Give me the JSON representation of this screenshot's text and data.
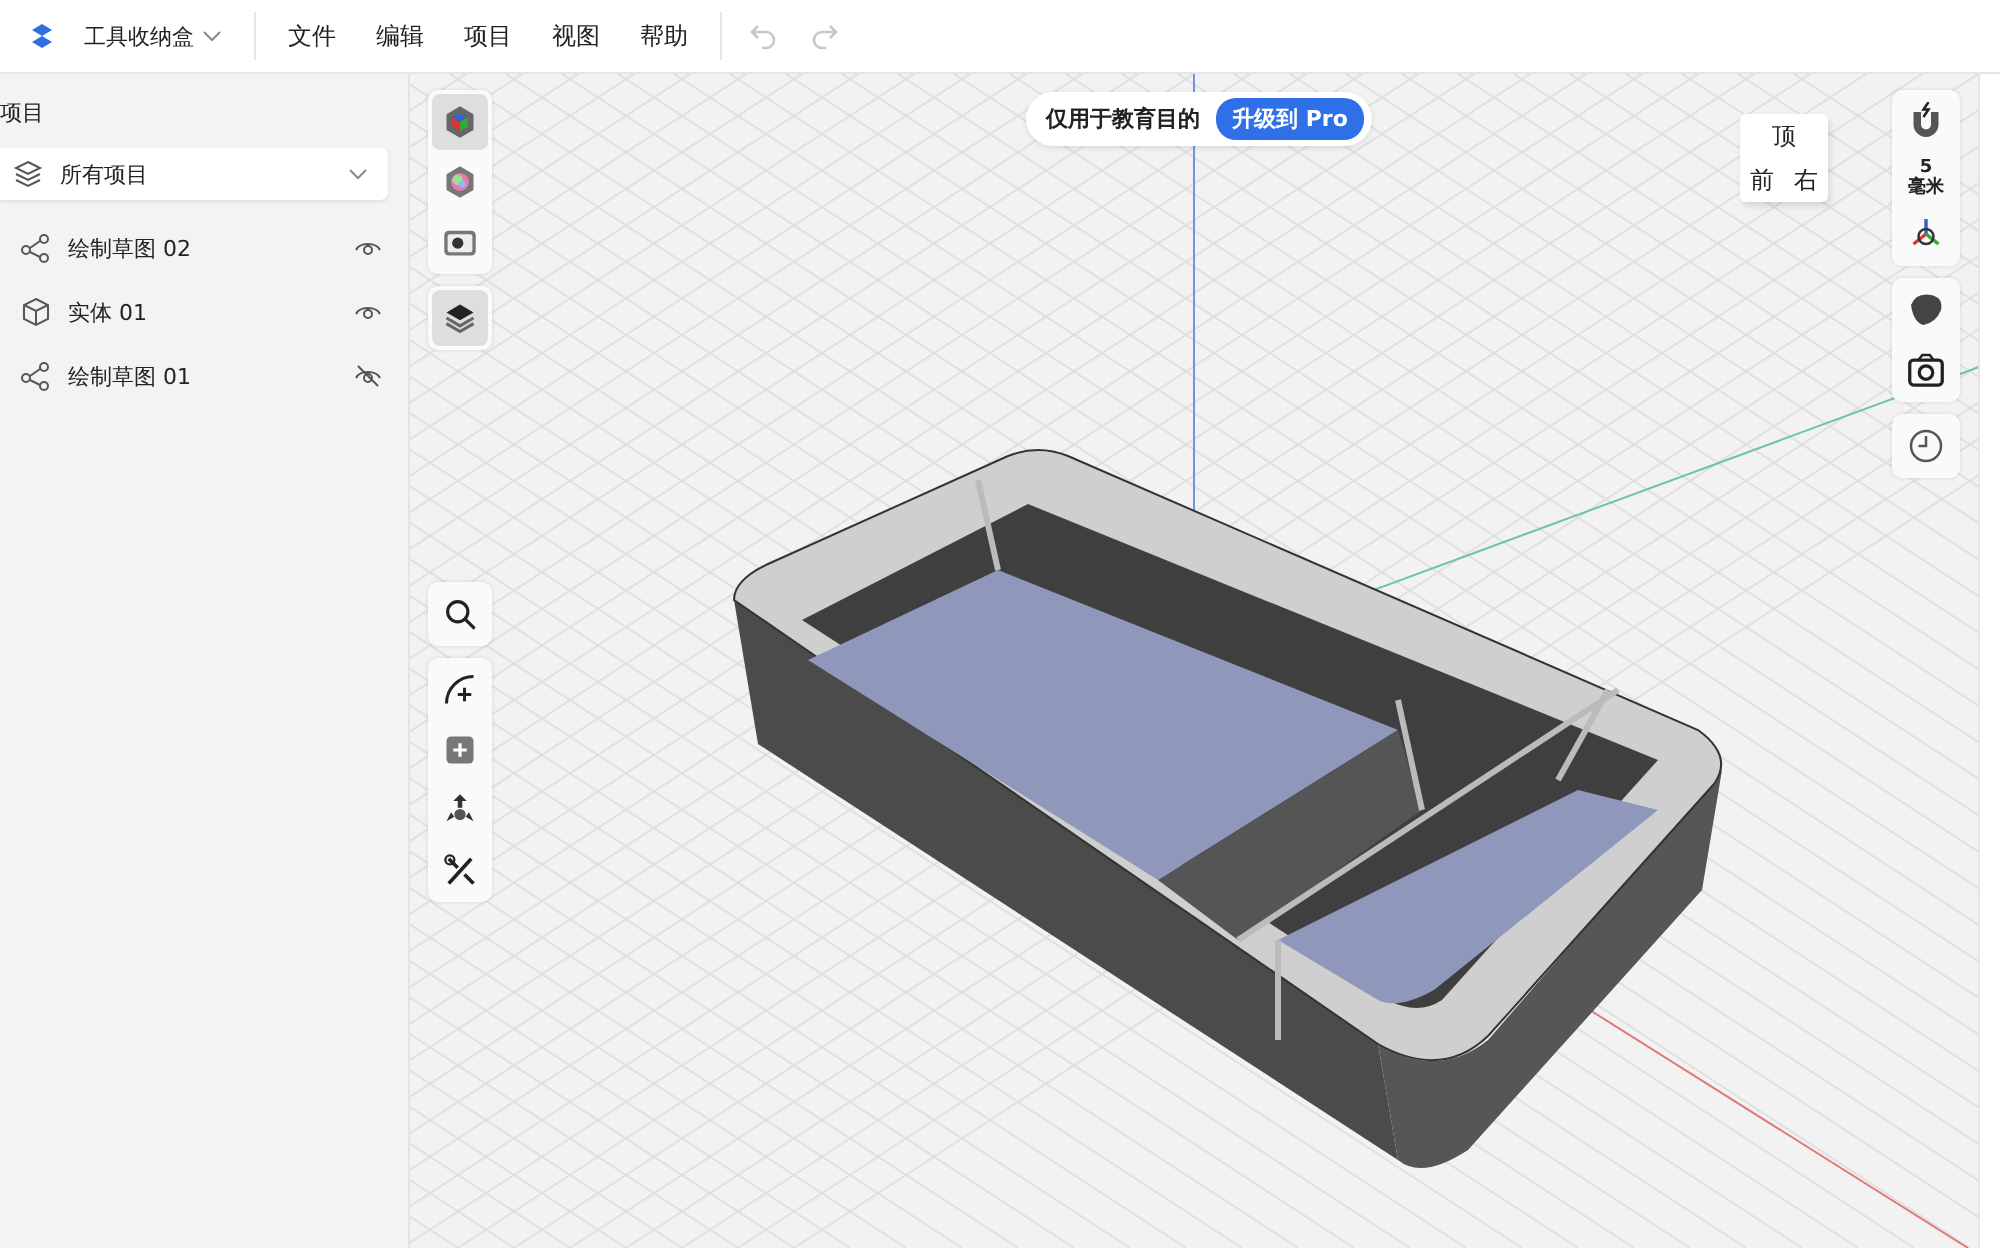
{
  "app": {
    "title": "工具收纳盒"
  },
  "menu": [
    {
      "label": "文件"
    },
    {
      "label": "编辑"
    },
    {
      "label": "项目"
    },
    {
      "label": "视图"
    },
    {
      "label": "帮助"
    }
  ],
  "history": [
    {
      "kind": "undo",
      "disabled": true
    },
    {
      "kind": "redo",
      "disabled": true
    }
  ],
  "sidebar": {
    "title": "项目",
    "filter": "所有项目",
    "items": [
      {
        "name": "绘制草图 02",
        "kind": "sketch",
        "visible": true
      },
      {
        "name": "实体  01",
        "kind": "body",
        "visible": true
      },
      {
        "name": "绘制草图 01",
        "kind": "sketch",
        "visible": false
      }
    ]
  },
  "banner": {
    "text": "仅用于教育目的",
    "button": "升级到 Pro"
  },
  "view_tools": [
    [
      {
        "kind": "appearance",
        "selected": true
      },
      {
        "kind": "material",
        "selected": false
      },
      {
        "kind": "render",
        "selected": false
      }
    ],
    [
      {
        "kind": "layers",
        "selected": true
      }
    ]
  ],
  "edit_tools": [
    [
      {
        "kind": "search"
      }
    ],
    [
      {
        "kind": "sketch"
      },
      {
        "kind": "add"
      },
      {
        "kind": "move"
      },
      {
        "kind": "tools"
      }
    ]
  ],
  "view_cube": {
    "faces": [
      "顶",
      "前",
      "右"
    ]
  },
  "snap": {
    "value": "5",
    "unit": "毫米"
  },
  "right_tools": [
    [
      {
        "kind": "magnet"
      },
      {
        "kind": "snap"
      },
      {
        "kind": "axes"
      }
    ],
    [
      {
        "kind": "shade"
      },
      {
        "kind": "camera"
      }
    ],
    [
      {
        "kind": "history"
      }
    ]
  ]
}
